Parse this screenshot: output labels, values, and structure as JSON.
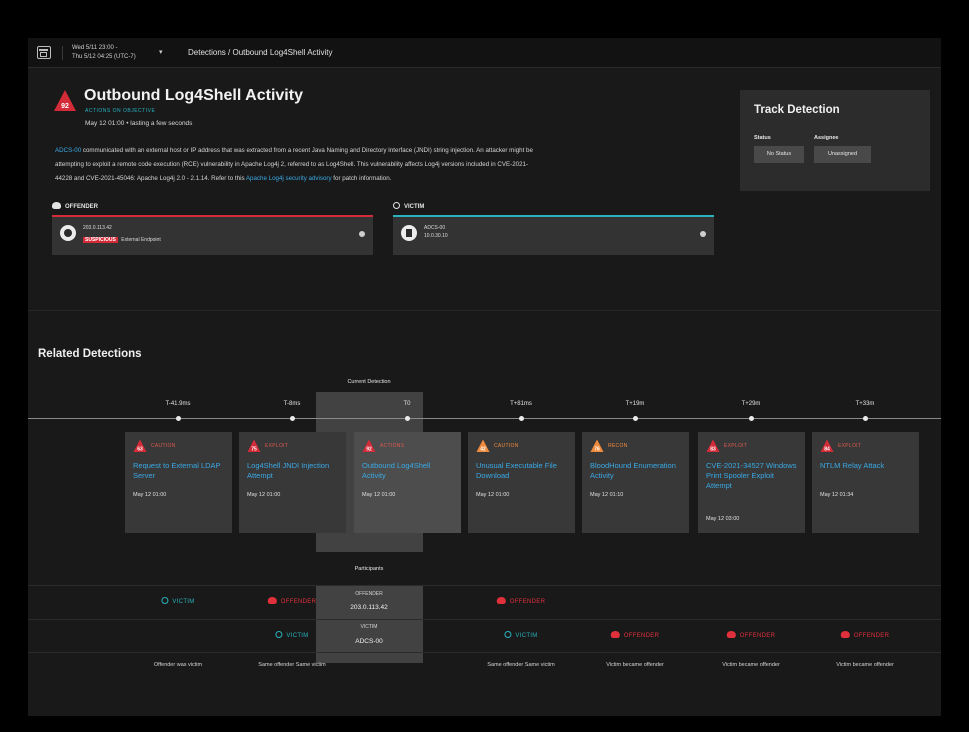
{
  "header": {
    "range_line1": "Wed 5/11 23:00 -",
    "range_line2": "Thu 5/12 04:25 (UTC-7)",
    "caret": "▾",
    "breadcrumb": "Detections / Outbound Log4Shell Activity"
  },
  "detection": {
    "score": "92",
    "title": "Outbound Log4Shell Activity",
    "stage": "ACTIONS ON OBJECTIVE",
    "when": "May 12 01:00 • lasting a few seconds",
    "description": {
      "host_link": "ADCS-00",
      "line1": " communicated with an external host or IP address that was extracted from a recent Java Naming and Directory Interface (JNDI) string injection. An attacker might be",
      "line2": "attempting to exploit a remote code execution (RCE) vulnerability in Apache Log4j 2, referred to as Log4Shell. This vulnerability affects Log4j versions included in CVE-2021-",
      "line3a": "44228 and CVE-2021-45046: Apache Log4j 2.0 - 2.1.14. Refer to this ",
      "advisory_link": "Apache Log4j security advisory",
      "line3b": " for patch information."
    }
  },
  "track": {
    "title": "Track Detection",
    "status_label": "Status",
    "assignee_label": "Assignee",
    "status_value": "No Status",
    "assignee_value": "Unassigned"
  },
  "offender": {
    "header": "OFFENDER",
    "ip": "203.0.113.42",
    "tag": "SUSPICIOUS",
    "type": "External Endpoint"
  },
  "victim": {
    "header": "VICTIM",
    "host": "ADCS-00",
    "ip": "10.0.30.10"
  },
  "related": {
    "title": "Related Detections",
    "current_label": "Current Detection",
    "participants_label": "Participants",
    "items": [
      {
        "offset": "T-41.9ms",
        "score": "63",
        "stage": "CAUTION",
        "title": "Request to External LDAP Server",
        "time": "May 12 01:00",
        "kind": "alert"
      },
      {
        "offset": "T-8ms",
        "score": "75",
        "stage": "EXPLOIT",
        "title": "Log4Shell JNDI Injection Attempt",
        "time": "May 12 01:00",
        "kind": "alert"
      },
      {
        "offset": "T0",
        "score": "92",
        "stage": "ACTIONS",
        "title": "Outbound Log4Shell Activity",
        "time": "May 12 01:00",
        "kind": "alert"
      },
      {
        "offset": "T+81ms",
        "score": "42",
        "stage": "CAUTION",
        "title": "Unusual Executable File Download",
        "time": "May 12 01:00",
        "kind": "caution"
      },
      {
        "offset": "T+19m",
        "score": "76",
        "stage": "RECON",
        "title": "BloodHound Enumeration Activity",
        "time": "May 12 01:10",
        "kind": "caution"
      },
      {
        "offset": "T+29m",
        "score": "83",
        "stage": "EXPLOIT",
        "title": "CVE-2021-34527 Windows Print Spooler Exploit Attempt",
        "time": "May 12 03:00",
        "kind": "alert"
      },
      {
        "offset": "T+33m",
        "score": "84",
        "stage": "EXPLOIT",
        "title": "NTLM Relay Attack",
        "time": "May 12 01:34",
        "kind": "alert"
      }
    ],
    "row_offender_roles": [
      "VICTIM",
      "OFFENDER",
      "",
      "OFFENDER",
      "",
      "",
      ""
    ],
    "row_victim_roles": [
      "",
      "VICTIM",
      "",
      "VICTIM",
      "OFFENDER",
      "OFFENDER",
      "OFFENDER"
    ],
    "center_offender_label": "OFFENDER",
    "center_offender_value": "203.0.113.42",
    "center_victim_label": "VICTIM",
    "center_victim_value": "ADCS-00",
    "captions": [
      "Offender was victim",
      "Same offender Same victim",
      "",
      "Same offender Same victim",
      "Victim became offender",
      "Victim became offender",
      "Victim became offender"
    ]
  },
  "colors": {
    "offender_red": "#d42b38",
    "victim_teal": "#2ab3bd",
    "link_blue": "#3aa9e5",
    "caution_orange": "#f08a3c"
  }
}
